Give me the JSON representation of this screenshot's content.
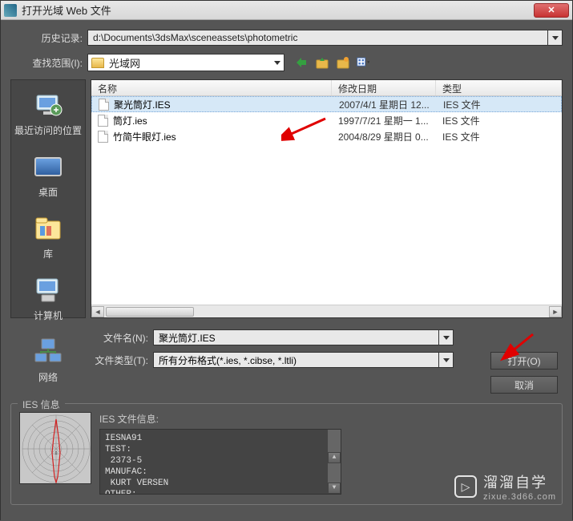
{
  "window": {
    "title": "打开光域 Web 文件"
  },
  "history": {
    "label": "历史记录:",
    "value": "d:\\Documents\\3dsMax\\sceneassets\\photometric"
  },
  "lookin": {
    "label": "查找范围(I):",
    "folder": "光域网"
  },
  "columns": {
    "name": "名称",
    "date": "修改日期",
    "type": "类型"
  },
  "files": [
    {
      "name": "聚光筒灯.IES",
      "date": "2007/4/1 星期日 12...",
      "type": "IES 文件",
      "selected": true
    },
    {
      "name": "筒灯.ies",
      "date": "1997/7/21 星期一 1...",
      "type": "IES 文件",
      "selected": false
    },
    {
      "name": "竹简牛眼灯.ies",
      "date": "2004/8/29 星期日 0...",
      "type": "IES 文件",
      "selected": false
    }
  ],
  "filename": {
    "label": "文件名(N):",
    "value": "聚光筒灯.IES"
  },
  "filetype": {
    "label": "文件类型(T):",
    "value": "所有分布格式(*.ies, *.cibse, *.ltli)"
  },
  "buttons": {
    "open": "打开(O)",
    "cancel": "取消"
  },
  "ies": {
    "frame_label": "IES 信息",
    "info_label": "IES 文件信息:",
    "lines": "IESNA91\nTEST:\n 2373-5\nMANUFAC:\n KURT VERSEN\nOTHER:"
  },
  "places": {
    "recent": "最近访问的位置",
    "desktop": "桌面",
    "libraries": "库",
    "computer": "计算机",
    "network": "网络"
  },
  "watermark": {
    "text": "溜溜自学",
    "sub": "zixue.3d66.com"
  }
}
